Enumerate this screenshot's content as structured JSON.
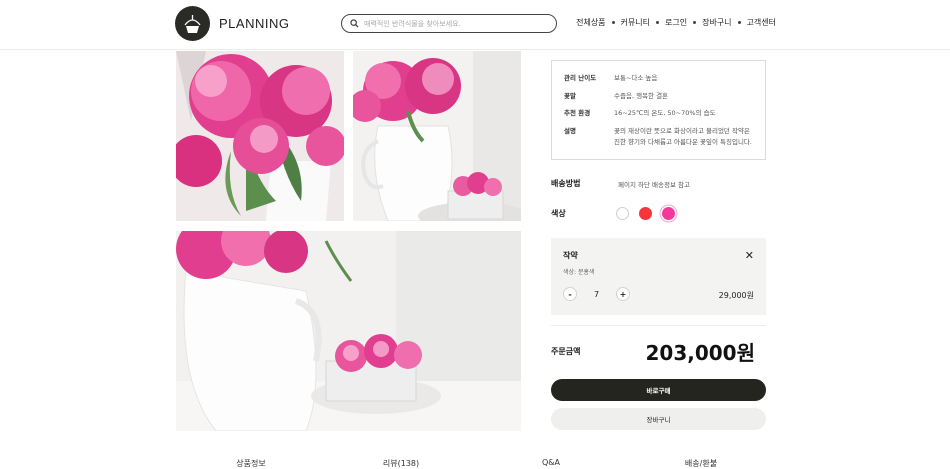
{
  "header": {
    "logo_text": "PLANNING",
    "search": {
      "placeholder": "매력적인 반려식물을 찾아보세요."
    },
    "nav": [
      "전체상품",
      "커뮤니티",
      "로그인",
      "장바구니",
      "고객센터"
    ]
  },
  "gallery": {
    "images": [
      "peony-closeup-photo",
      "peony-vase-photo",
      "peony-table-photo"
    ]
  },
  "product_info": {
    "rows": [
      {
        "label": "관리 난이도",
        "value": "보통~다소 높음"
      },
      {
        "label": "꽃말",
        "value": "수줍음, 행복한 결혼"
      },
      {
        "label": "추천 환경",
        "value": "16~25℃의 온도, 50~70%의 습도"
      },
      {
        "label": "설명",
        "value": "꽃의 재상이란 뜻으로 화상이라고 불리었던 작약은 진한 향기와 다채롭고 아름다운 꽃잎이 특징입니다."
      }
    ]
  },
  "shipping": {
    "label": "배송방법",
    "value": "페이지 하단 배송정보 참고"
  },
  "color": {
    "label": "색상",
    "swatches": [
      {
        "name": "white",
        "hex": "#ffffff"
      },
      {
        "name": "red",
        "hex": "#f8353a"
      },
      {
        "name": "pink",
        "hex": "#f33a9b",
        "selected": true
      }
    ]
  },
  "selected_option": {
    "name": "작약",
    "sub": "색상: 분홍색",
    "close_icon": "close-icon",
    "minus": "-",
    "quantity": "7",
    "plus": "+",
    "price": "29,000원"
  },
  "total": {
    "label": "주문금액",
    "value": "203,000원"
  },
  "buttons": {
    "buy": "바로구매",
    "cart": "장바구니"
  },
  "tabs": [
    "상품정보",
    "리뷰(138)",
    "Q&A",
    "배송/환불"
  ],
  "colors": {
    "dark": "#252520",
    "accent_pink": "#f33a9b",
    "accent_red": "#f8353a",
    "panel_bg": "#f3f3f1"
  }
}
